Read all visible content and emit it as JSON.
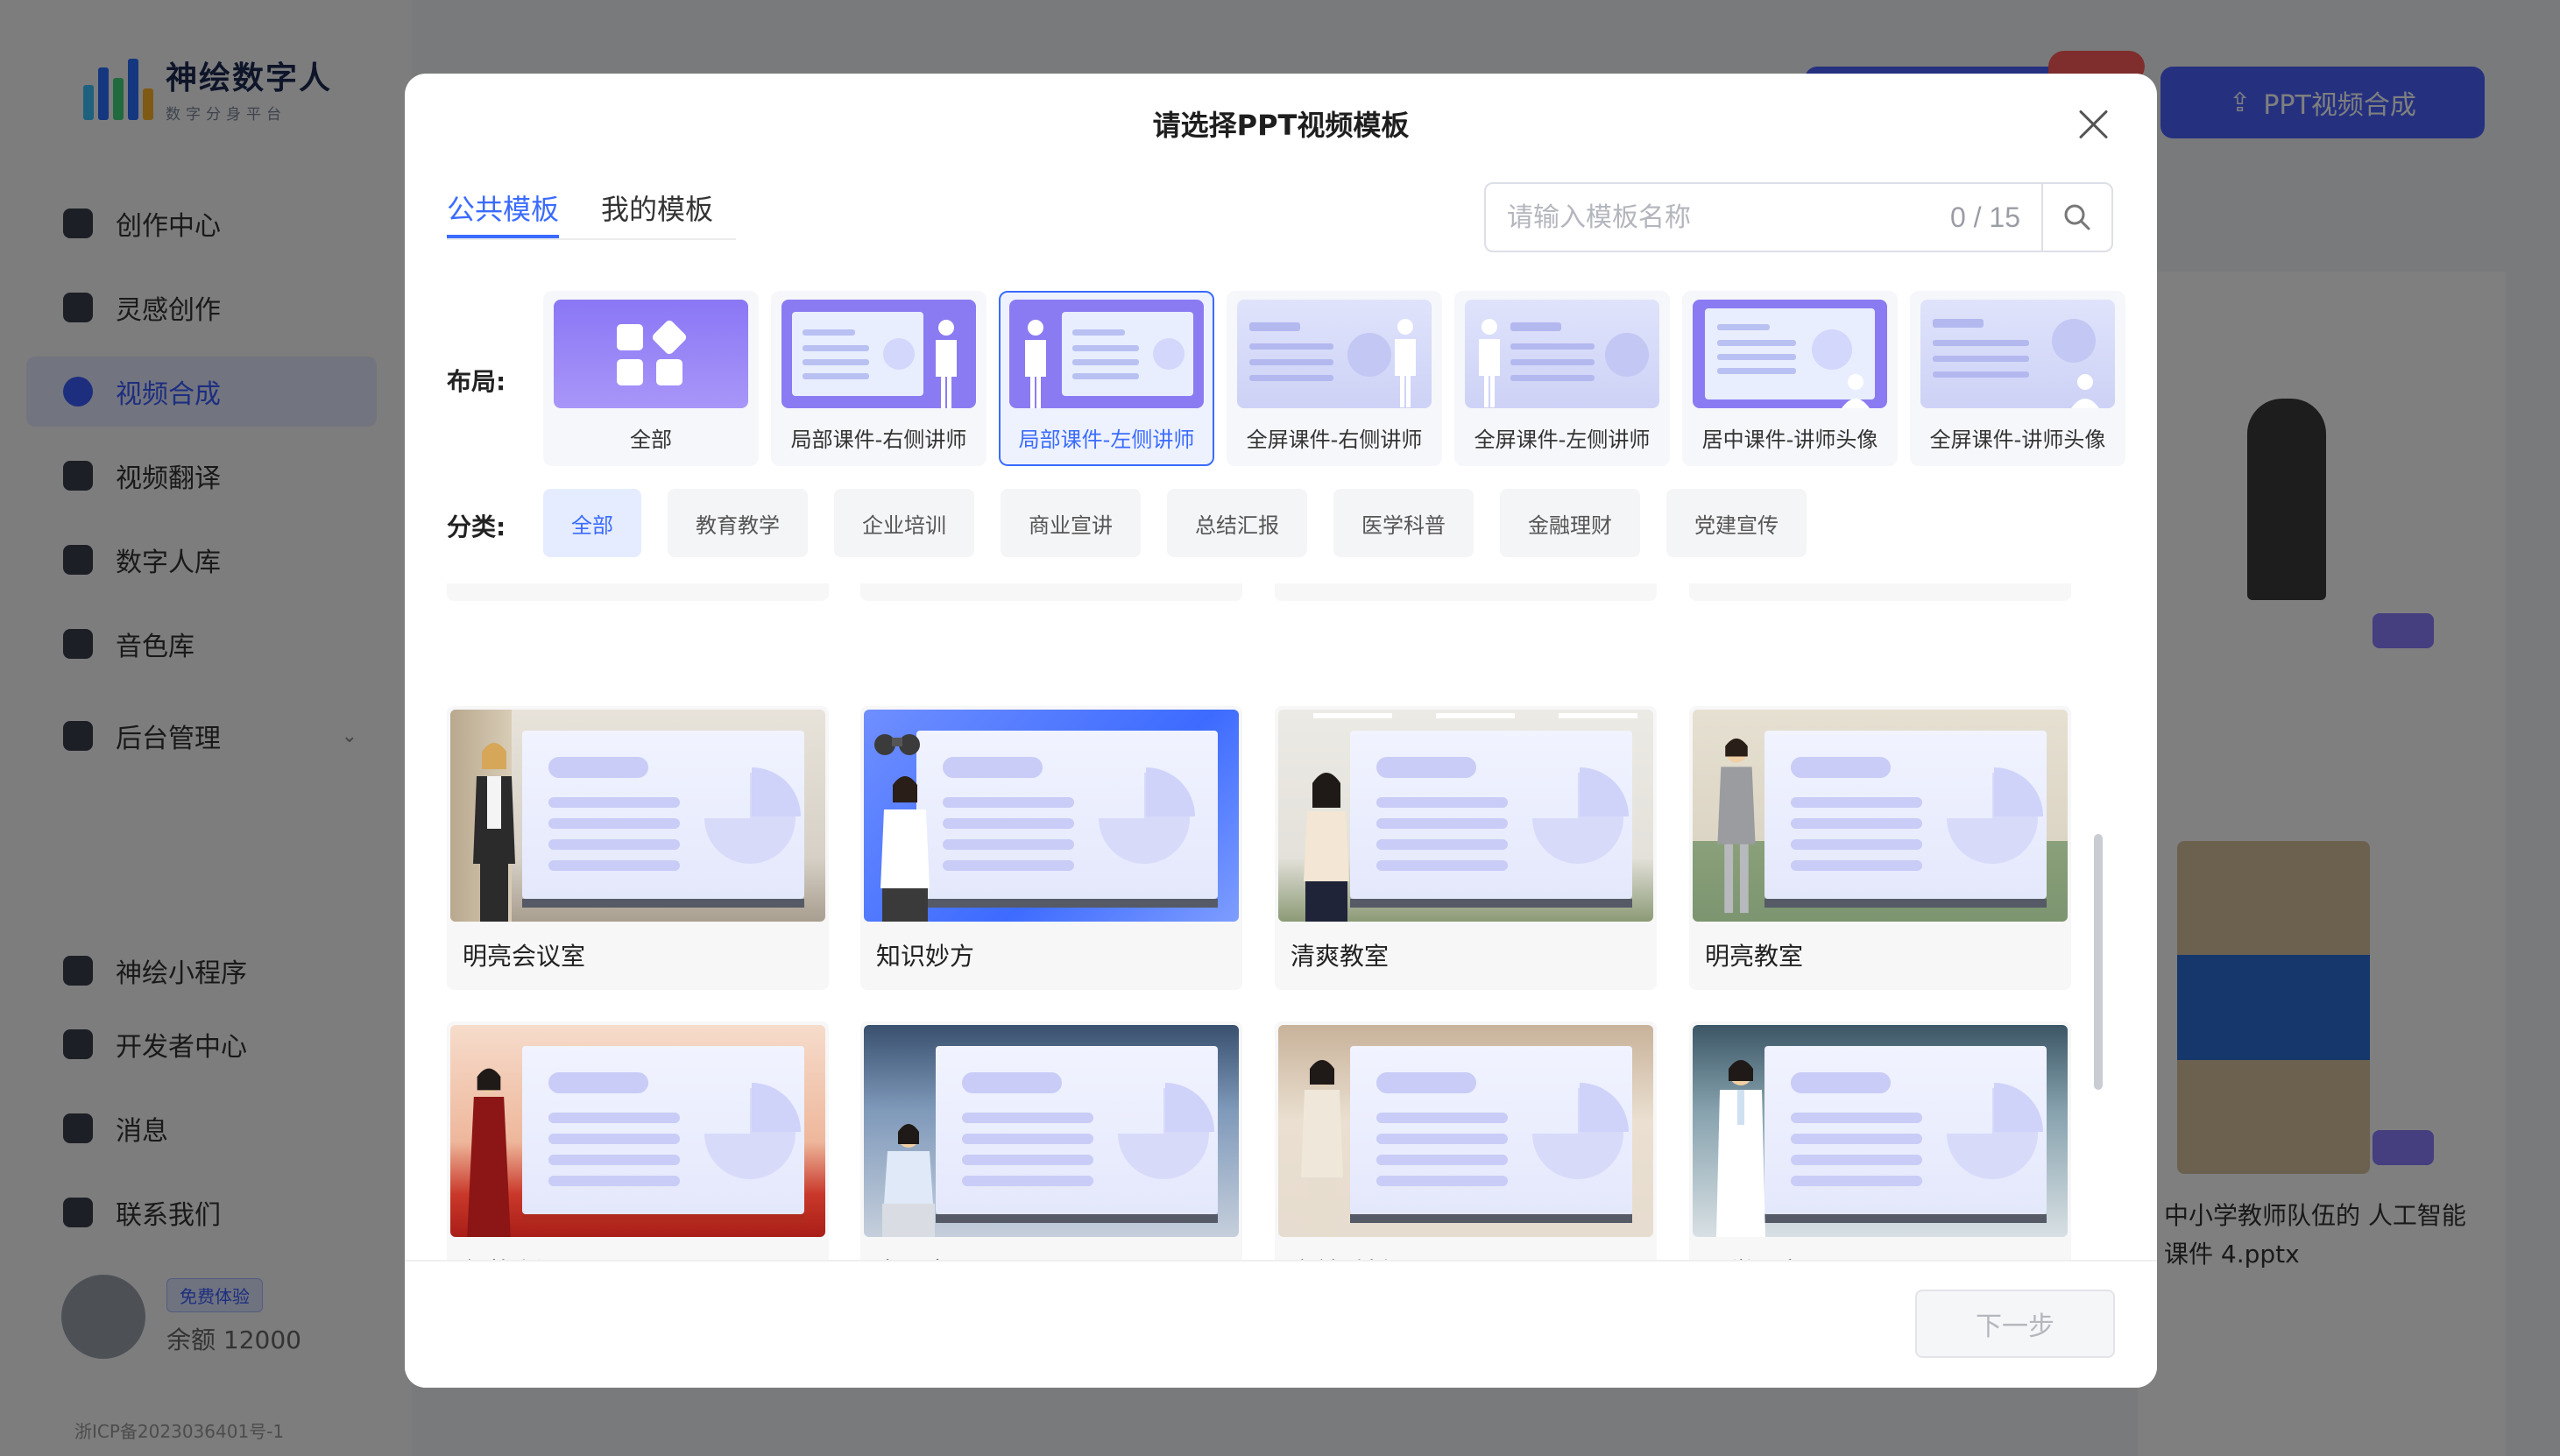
{
  "background_app": {
    "logo_title": "神绘数字人",
    "logo_subtitle": "数字分身平台",
    "nav": [
      {
        "label": "创作中心"
      },
      {
        "label": "灵感创作"
      },
      {
        "label": "视频合成"
      },
      {
        "label": "视频翻译"
      },
      {
        "label": "数字人库"
      },
      {
        "label": "音色库"
      },
      {
        "label": "后台管理"
      },
      {
        "label": "神绘小程序"
      },
      {
        "label": "开发者中心"
      },
      {
        "label": "消息"
      },
      {
        "label": "联系我们"
      }
    ],
    "user_badge": "免费体验",
    "user_balance": "余额 12000",
    "icp": "浙ICP备2023036401号-1",
    "primary_action": "PPT视频合成",
    "bg_card_text": "中小学教师队伍的 人工智能 课件 4.pptx"
  },
  "modal": {
    "title": "请选择PPT视频模板",
    "tabs": [
      {
        "label": "公共模板",
        "active": true
      },
      {
        "label": "我的模板",
        "active": false
      }
    ],
    "search": {
      "placeholder": "请输入模板名称",
      "count": "0 / 15"
    },
    "layout_label": "布局:",
    "layouts": [
      {
        "name": "全部",
        "selected": false
      },
      {
        "name": "局部课件-右侧讲师",
        "selected": false
      },
      {
        "name": "局部课件-左侧讲师",
        "selected": true
      },
      {
        "name": "全屏课件-右侧讲师",
        "selected": false
      },
      {
        "name": "全屏课件-左侧讲师",
        "selected": false
      },
      {
        "name": "居中课件-讲师头像",
        "selected": false
      },
      {
        "name": "全屏课件-讲师头像",
        "selected": false
      }
    ],
    "category_label": "分类:",
    "categories": [
      {
        "name": "全部",
        "active": true
      },
      {
        "name": "教育教学",
        "active": false
      },
      {
        "name": "企业培训",
        "active": false
      },
      {
        "name": "商业宣讲",
        "active": false
      },
      {
        "name": "总结汇报",
        "active": false
      },
      {
        "name": "医学科普",
        "active": false
      },
      {
        "name": "金融理财",
        "active": false
      },
      {
        "name": "党建宣传",
        "active": false
      }
    ],
    "templates": [
      {
        "name": "明亮会议室"
      },
      {
        "name": "知识妙方"
      },
      {
        "name": "清爽教室"
      },
      {
        "name": "明亮教室"
      },
      {
        "name": "气壮山河"
      },
      {
        "name": "交易大厅"
      },
      {
        "name": "案前时刻"
      },
      {
        "name": "医学研究"
      }
    ],
    "next_button": "下一步"
  },
  "colors": {
    "accent": "#3a6bff",
    "layout_thumb_purple": "#8b7bf2"
  }
}
